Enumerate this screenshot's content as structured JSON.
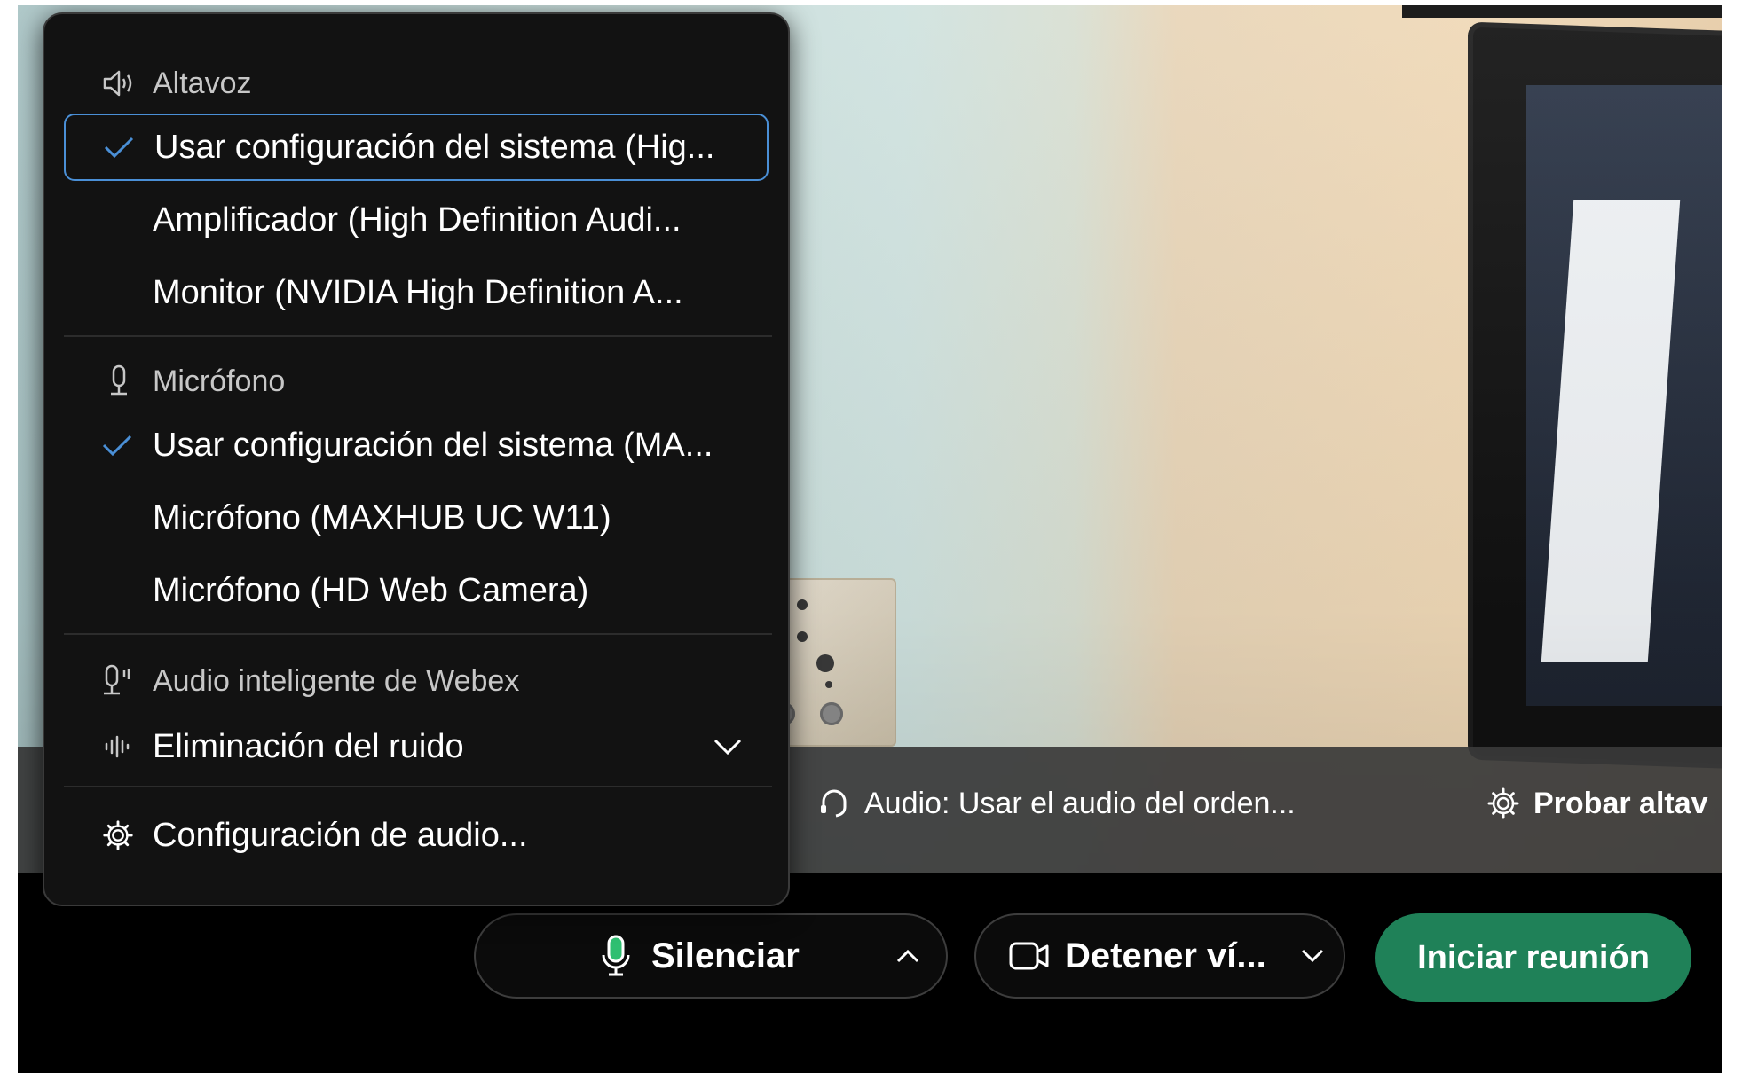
{
  "speaker_section": {
    "heading": "Altavoz",
    "options": [
      {
        "label": "Usar configuración del sistema (Hig...",
        "checked": true
      },
      {
        "label": "Amplificador (High Definition Audi...",
        "checked": false
      },
      {
        "label": "Monitor (NVIDIA High Definition A...",
        "checked": false
      }
    ]
  },
  "microphone_section": {
    "heading": "Micrófono",
    "options": [
      {
        "label": "Usar configuración del sistema (MA...",
        "checked": true
      },
      {
        "label": "Micrófono (MAXHUB UC W11)",
        "checked": false
      },
      {
        "label": "Micrófono (HD Web Camera)",
        "checked": false
      }
    ]
  },
  "smart_audio_section": {
    "heading": "Audio inteligente de Webex",
    "noise_option_label": "Eliminación del ruido"
  },
  "audio_settings_label": "Configuración de audio...",
  "preview_bar": {
    "audio_label": "Audio: Usar el audio del orden...",
    "test_label": "Probar altav"
  },
  "controls": {
    "mute_label": "Silenciar",
    "video_label": "Detener ví...",
    "start_label": "Iniciar reunión"
  },
  "colors": {
    "accent_green": "#1f8158",
    "selection_border": "#4a8fd6",
    "check_blue": "#4a8fd6",
    "menu_bg": "#121212"
  }
}
